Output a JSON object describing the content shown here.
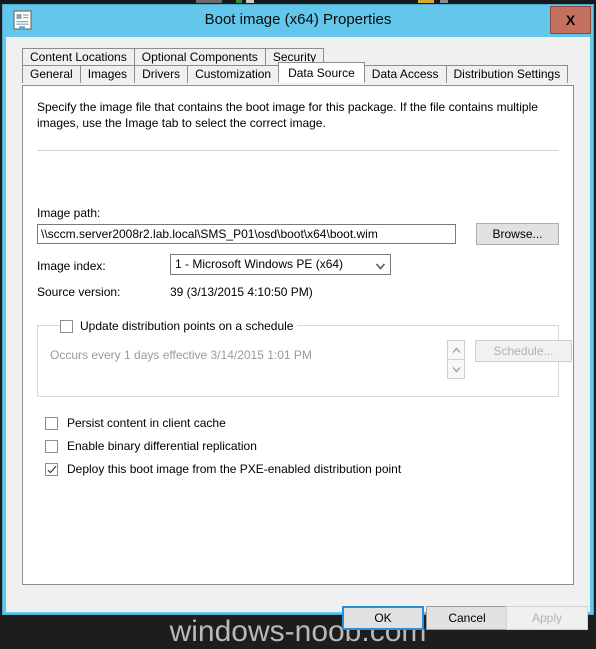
{
  "window": {
    "title": "Boot image (x64) Properties",
    "icon": "properties-window-icon",
    "close_label": "X"
  },
  "tabs": {
    "row1": [
      {
        "label": "Content Locations",
        "active": false
      },
      {
        "label": "Optional Components",
        "active": false
      },
      {
        "label": "Security",
        "active": false
      }
    ],
    "row2": [
      {
        "label": "General",
        "active": false
      },
      {
        "label": "Images",
        "active": false
      },
      {
        "label": "Drivers",
        "active": false
      },
      {
        "label": "Customization",
        "active": false
      },
      {
        "label": "Data Source",
        "active": true
      },
      {
        "label": "Data Access",
        "active": false
      },
      {
        "label": "Distribution Settings",
        "active": false
      }
    ]
  },
  "page": {
    "description": "Specify the image file that contains the boot image for this package. If the file contains multiple images, use the Image tab to select the correct image.",
    "image_path_label": "Image path:",
    "image_path_value": "\\\\sccm.server2008r2.lab.local\\SMS_P01\\osd\\boot\\x64\\boot.wim",
    "browse_label": "Browse...",
    "image_index_label": "Image index:",
    "image_index_value": "1 - Microsoft Windows PE (x64)",
    "source_version_label": "Source version:",
    "source_version_value": "39 (3/13/2015 4:10:50 PM)"
  },
  "schedule_group": {
    "checkbox_label": "Update distribution points on a schedule",
    "checked": false,
    "occurrence_text": "Occurs every 1 days effective 3/14/2015 1:01 PM",
    "schedule_button_label": "Schedule...",
    "schedule_button_enabled": false
  },
  "options": [
    {
      "label": "Persist content in client cache",
      "checked": false
    },
    {
      "label": "Enable binary differential replication",
      "checked": false
    },
    {
      "label": "Deploy this boot image from the PXE-enabled distribution point",
      "checked": true
    }
  ],
  "footer": {
    "ok_label": "OK",
    "cancel_label": "Cancel",
    "apply_label": "Apply",
    "apply_enabled": false
  },
  "watermark": "windows-noob.com",
  "colors": {
    "titlebar": "#62c7ea",
    "close_button": "#c4705f",
    "dialog_face": "#f0f0f0",
    "page_background": "#ffffff",
    "focus_border": "#2a8fd4",
    "disabled_text": "#b0b0b0"
  }
}
